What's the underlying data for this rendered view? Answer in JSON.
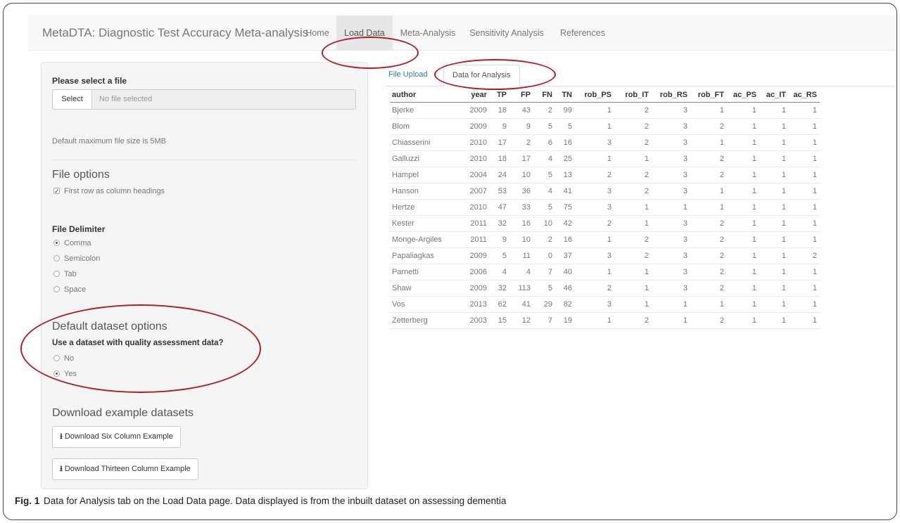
{
  "app": {
    "brand": "MetaDTA: Diagnostic Test Accuracy Meta-analysis",
    "nav": [
      "Home",
      "Load Data",
      "Meta-Analysis",
      "Sensitivity Analysis",
      "References"
    ],
    "active_nav": "Load Data"
  },
  "sidebar": {
    "select_file_label": "Please select a file",
    "select_button": "Select",
    "file_placeholder": "No file selected",
    "max_size_note": "Default maximum file size is 5MB",
    "file_options_heading": "File options",
    "first_row_header_label": "First row as column headings",
    "first_row_header_checked": true,
    "delimiter_label": "File Delimiter",
    "delimiters": [
      "Comma",
      "Semicolon",
      "Tab",
      "Space"
    ],
    "delimiter_selected": "Comma",
    "default_dataset_heading": "Default dataset options",
    "quality_question": "Use a dataset with quality assessment data?",
    "quality_options": [
      "No",
      "Yes"
    ],
    "quality_selected": "Yes",
    "download_heading": "Download example datasets",
    "download_six": "Download Six Column Example",
    "download_thirteen": "Download Thirteen Column Example"
  },
  "main": {
    "tabs": [
      "File Upload",
      "Data for Analysis"
    ],
    "active_tab": "Data for Analysis",
    "table": {
      "columns": [
        "author",
        "year",
        "TP",
        "FP",
        "FN",
        "TN",
        "rob_PS",
        "rob_IT",
        "rob_RS",
        "rob_FT",
        "ac_PS",
        "ac_IT",
        "ac_RS"
      ],
      "rows": [
        [
          "Bjerke",
          "2009",
          "18",
          "43",
          "2",
          "99",
          "1",
          "2",
          "3",
          "1",
          "1",
          "1",
          "1"
        ],
        [
          "Blom",
          "2009",
          "9",
          "9",
          "5",
          "5",
          "1",
          "2",
          "3",
          "2",
          "1",
          "1",
          "1"
        ],
        [
          "Chiasserini",
          "2010",
          "17",
          "2",
          "6",
          "16",
          "3",
          "2",
          "3",
          "1",
          "1",
          "1",
          "1"
        ],
        [
          "Galluzzi",
          "2010",
          "18",
          "17",
          "4",
          "25",
          "1",
          "1",
          "3",
          "2",
          "1",
          "1",
          "1"
        ],
        [
          "Hampel",
          "2004",
          "24",
          "10",
          "5",
          "13",
          "2",
          "2",
          "3",
          "2",
          "1",
          "1",
          "1"
        ],
        [
          "Hanson",
          "2007",
          "53",
          "36",
          "4",
          "41",
          "3",
          "2",
          "3",
          "1",
          "1",
          "1",
          "1"
        ],
        [
          "Hertze",
          "2010",
          "47",
          "33",
          "5",
          "75",
          "3",
          "1",
          "1",
          "1",
          "1",
          "1",
          "1"
        ],
        [
          "Kester",
          "2011",
          "32",
          "16",
          "10",
          "42",
          "2",
          "1",
          "3",
          "2",
          "1",
          "1",
          "1"
        ],
        [
          "Monge-Argiles",
          "2011",
          "9",
          "10",
          "2",
          "16",
          "1",
          "2",
          "3",
          "2",
          "1",
          "1",
          "1"
        ],
        [
          "Papaliagkas",
          "2009",
          "5",
          "11",
          "0",
          "37",
          "3",
          "2",
          "3",
          "2",
          "1",
          "1",
          "2"
        ],
        [
          "Parnetti",
          "2006",
          "4",
          "4",
          "7",
          "40",
          "1",
          "1",
          "3",
          "2",
          "1",
          "1",
          "1"
        ],
        [
          "Shaw",
          "2009",
          "32",
          "113",
          "5",
          "46",
          "2",
          "1",
          "3",
          "2",
          "1",
          "1",
          "1"
        ],
        [
          "Vos",
          "2013",
          "62",
          "41",
          "29",
          "82",
          "3",
          "1",
          "1",
          "1",
          "1",
          "1",
          "1"
        ],
        [
          "Zetterberg",
          "2003",
          "15",
          "12",
          "7",
          "19",
          "1",
          "2",
          "1",
          "2",
          "1",
          "1",
          "1"
        ]
      ]
    }
  },
  "caption": {
    "label": "Fig. 1",
    "text": "Data for Analysis tab on the Load Data page. Data displayed is from the inbuilt dataset on assessing dementia"
  },
  "colors": {
    "annotation": "#b01e23",
    "navbar_bg": "#f8f8f8",
    "active_nav_bg": "#e7e7e7",
    "sidebar_bg": "#f5f5f5",
    "link": "#337ab7"
  }
}
